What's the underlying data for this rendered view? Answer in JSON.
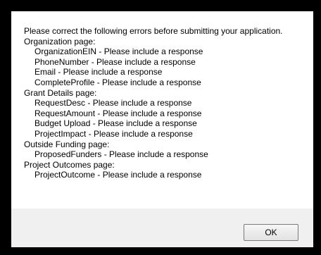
{
  "message": {
    "intro": "Please correct the following errors before submitting your application.",
    "sections": [
      {
        "heading": "Organization page:",
        "items": [
          "OrganizationEIN - Please include a response",
          "PhoneNumber - Please include a response",
          "Email - Please include a response",
          "CompleteProfile - Please include a response"
        ]
      },
      {
        "heading": "Grant Details page:",
        "items": [
          "RequestDesc - Please include a response",
          "RequestAmount - Please include a response",
          "Budget Upload - Please include a response",
          "ProjectImpact - Please include a response"
        ]
      },
      {
        "heading": "Outside Funding page:",
        "items": [
          "ProposedFunders - Please include a response"
        ]
      },
      {
        "heading": "Project Outcomes page:",
        "items": [
          "ProjectOutcome - Please include a response"
        ]
      }
    ]
  },
  "buttons": {
    "ok_label": "OK"
  }
}
